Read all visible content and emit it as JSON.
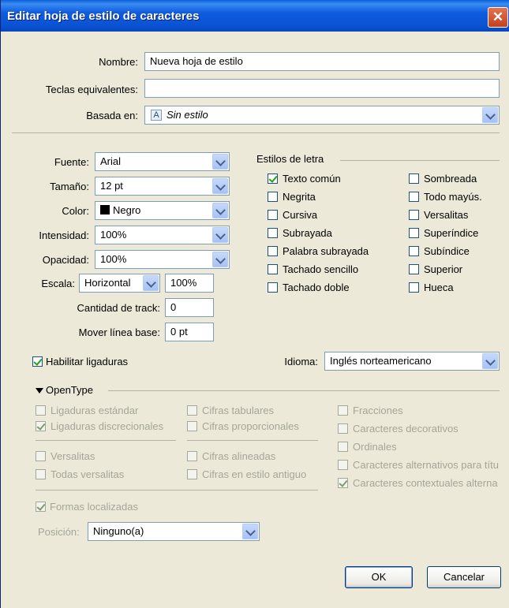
{
  "window": {
    "title": "Editar hoja de estilo de caracteres",
    "close_glyph": "✕"
  },
  "general": {
    "name_label": "Nombre:",
    "name_value": "Nueva hoja de estilo",
    "shortcut_label": "Teclas equivalentes:",
    "shortcut_value": "",
    "based_on_label": "Basada en:",
    "based_on_value": "Sin estilo",
    "based_on_icon_glyph": "A"
  },
  "font": {
    "font_label": "Fuente:",
    "font_value": "Arial",
    "size_label": "Tamaño:",
    "size_value": "12 pt",
    "color_label": "Color:",
    "color_value": "Negro",
    "color_swatch": "#000000",
    "intensity_label": "Intensidad:",
    "intensity_value": "100%",
    "opacity_label": "Opacidad:",
    "opacity_value": "100%",
    "scale_label": "Escala:",
    "scale_direction": "Horizontal",
    "scale_value": "100%",
    "tracking_label": "Cantidad de track:",
    "tracking_value": "0",
    "baseline_label": "Mover línea base:",
    "baseline_value": "0 pt"
  },
  "type_styles": {
    "heading": "Estilos de letra",
    "items": [
      {
        "label": "Texto común",
        "checked": true
      },
      {
        "label": "Negrita",
        "checked": false
      },
      {
        "label": "Cursiva",
        "checked": false
      },
      {
        "label": "Subrayada",
        "checked": false
      },
      {
        "label": "Palabra subrayada",
        "checked": false
      },
      {
        "label": "Tachado sencillo",
        "checked": false
      },
      {
        "label": "Tachado doble",
        "checked": false
      },
      {
        "label": "Sombreada",
        "checked": false
      },
      {
        "label": "Todo mayús.",
        "checked": false
      },
      {
        "label": "Versalitas",
        "checked": false
      },
      {
        "label": "Superíndice",
        "checked": false
      },
      {
        "label": "Subíndice",
        "checked": false
      },
      {
        "label": "Superior",
        "checked": false
      },
      {
        "label": "Hueca",
        "checked": false
      }
    ]
  },
  "ligatures": {
    "label": "Habilitar ligaduras",
    "checked": true
  },
  "language": {
    "label": "Idioma:",
    "value": "Inglés norteamericano"
  },
  "opentype": {
    "heading": "OpenType",
    "col1": [
      {
        "label": "Ligaduras estándar",
        "checked": false
      },
      {
        "label": "Ligaduras discrecionales",
        "checked": true
      },
      {
        "label": "Versalitas",
        "checked": false
      },
      {
        "label": "Todas versalitas",
        "checked": false
      }
    ],
    "col2": [
      {
        "label": "Cifras tabulares",
        "checked": false
      },
      {
        "label": "Cifras proporcionales",
        "checked": false
      },
      {
        "label": "Cifras alineadas",
        "checked": false
      },
      {
        "label": "Cifras en estilo antiguo",
        "checked": false
      }
    ],
    "col3": [
      {
        "label": "Fracciones",
        "checked": false
      },
      {
        "label": "Caracteres decorativos",
        "checked": false
      },
      {
        "label": "Ordinales",
        "checked": false
      },
      {
        "label": "Caracteres alternativos para títu",
        "checked": false
      },
      {
        "label": "Caracteres contextuales alterna",
        "checked": true
      }
    ],
    "localized_forms": {
      "label": "Formas localizadas",
      "checked": true
    },
    "position_label": "Posición:",
    "position_value": "Ninguno(a)"
  },
  "buttons": {
    "ok": "OK",
    "cancel": "Cancelar"
  }
}
